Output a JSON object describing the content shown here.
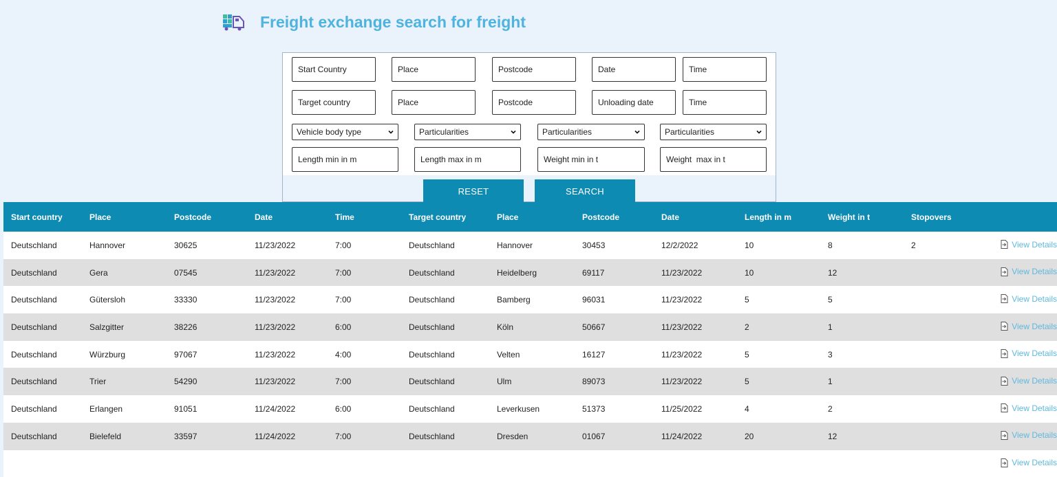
{
  "page": {
    "title": "Freight exchange search for freight",
    "title_icon": "freight-truck-icon",
    "accent_color": "#0e8bb3",
    "title_color": "#4fb3df"
  },
  "search": {
    "row1": [
      "Start Country",
      "Place",
      "Postcode",
      "Date",
      "Time"
    ],
    "row2": [
      "Target country",
      "Place",
      "Postcode",
      "Unloading date",
      "Time"
    ],
    "selects": [
      "Vehicle body type",
      "Particularities",
      "Particularities",
      "Particularities"
    ],
    "row4": [
      "Length min in m",
      "Length max in m",
      "Weight min in t",
      "Weight  max in t"
    ],
    "reset_label": "RESET",
    "search_label": "SEARCH"
  },
  "table": {
    "headers": [
      "Start country",
      "Place",
      "Postcode",
      "Date",
      "Time",
      "Target country",
      "Place",
      "Postcode",
      "Date",
      "Length in m",
      "Weight in t",
      "Stopovers",
      ""
    ],
    "details_label": "View Details",
    "rows": [
      [
        "Deutschland",
        "Hannover",
        "30625",
        "11/23/2022",
        "7:00",
        "Deutschland",
        "Hannover",
        "30453",
        "12/2/2022",
        "10",
        "8",
        "2"
      ],
      [
        "Deutschland",
        "Gera",
        "07545",
        "11/23/2022",
        "7:00",
        "Deutschland",
        "Heidelberg",
        "69117",
        "11/23/2022",
        "10",
        "12",
        ""
      ],
      [
        "Deutschland",
        "Gütersloh",
        "33330",
        "11/23/2022",
        "7:00",
        "Deutschland",
        "Bamberg",
        "96031",
        "11/23/2022",
        "5",
        "5",
        ""
      ],
      [
        "Deutschland",
        "Salzgitter",
        "38226",
        "11/23/2022",
        "6:00",
        "Deutschland",
        "Köln",
        "50667",
        "11/23/2022",
        "2",
        "1",
        ""
      ],
      [
        "Deutschland",
        "Würzburg",
        "97067",
        "11/23/2022",
        "4:00",
        "Deutschland",
        "Velten",
        "16127",
        "11/23/2022",
        "5",
        "3",
        ""
      ],
      [
        "Deutschland",
        "Trier",
        "54290",
        "11/23/2022",
        "7:00",
        "Deutschland",
        "Ulm",
        "89073",
        "11/23/2022",
        "5",
        "1",
        ""
      ],
      [
        "Deutschland",
        "Erlangen",
        "91051",
        "11/24/2022",
        "6:00",
        "Deutschland",
        "Leverkusen",
        "51373",
        "11/25/2022",
        "4",
        "2",
        ""
      ],
      [
        "Deutschland",
        "Bielefeld",
        "33597",
        "11/24/2022",
        "7:00",
        "Deutschland",
        "Dresden",
        "01067",
        "11/24/2022",
        "20",
        "12",
        ""
      ],
      [
        "",
        "",
        "",
        "",
        "",
        "",
        "",
        "",
        "",
        "",
        "",
        ""
      ]
    ]
  }
}
